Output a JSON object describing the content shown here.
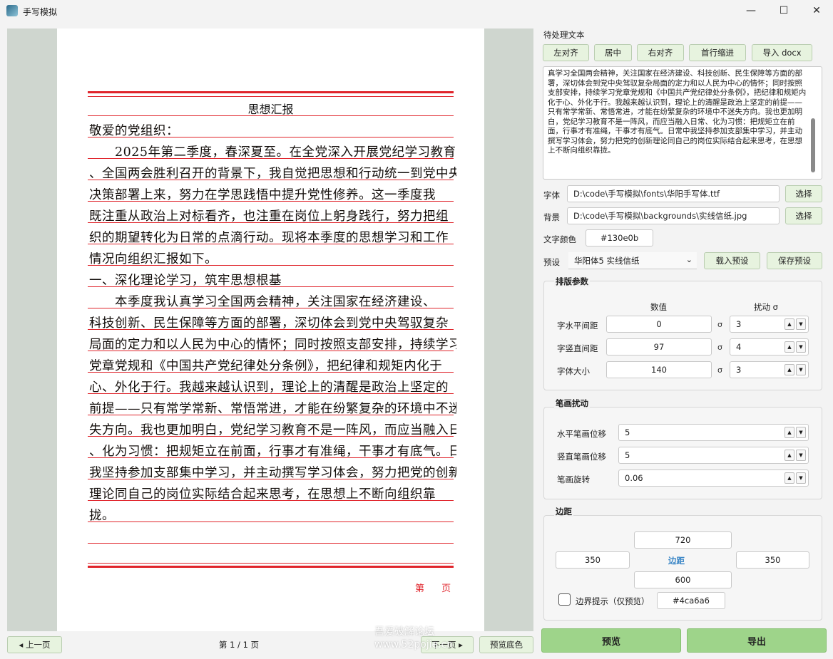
{
  "window": {
    "title": "手写模拟",
    "minimize": "—",
    "maximize": "☐",
    "close": "✕"
  },
  "paper": {
    "title": "思想汇报",
    "lines": [
      "敬爱的党组织：",
      "　　2025年第二季度，春深夏至。在全党深入开展党纪学习教育",
      "、全国两会胜利召开的背景下，我自觉把思想和行动统一到党中央",
      "决策部署上来，努力在学思践悟中提升党性修养。这一季度我",
      "既注重从政治上对标看齐，也注重在岗位上躬身践行，努力把组",
      "织的期望转化为日常的点滴行动。现将本季度的思想学习和工作",
      "情况向组织汇报如下。",
      "一、深化理论学习，筑牢思想根基",
      "　　本季度我认真学习全国两会精神，关注国家在经济建设、",
      "科技创新、民生保障等方面的部署，深切体会到党中央驾驭复杂",
      "局面的定力和以人民为中心的情怀；同时按照支部安排，持续学习",
      "党章党规和《中国共产党纪律处分条例》，把纪律和规矩内化于",
      "心、外化于行。我越来越认识到，理论上的清醒是政治上坚定的",
      "前提——只有常学常新、常悟常进，才能在纷繁复杂的环境中不迷",
      "失方向。我也更加明白，党纪学习教育不是一阵风，而应当融入日常",
      "、化为习惯：把规矩立在前面，行事才有准绳，干事才有底气。日常中",
      "我坚持参加支部集中学习，并主动撰写学习体会，努力把党的创新",
      "理论同自己的岗位实际结合起来思考，在思想上不断向组织靠",
      "拢。"
    ],
    "page_label": "第 页"
  },
  "nav": {
    "prev": "◂ 上一页",
    "indicator": "第 1 / 1 页",
    "next": "下一页 ▸",
    "preview_bg": "预览底色"
  },
  "watermark": {
    "line1": "吾爱破解论坛",
    "line2": "www.52pojie.cn"
  },
  "panel": {
    "text_label": "待处理文本",
    "align_left": "左对齐",
    "align_center": "居中",
    "align_right": "右对齐",
    "indent": "首行缩进",
    "import_docx": "导入 docx",
    "text_content": "真学习全国两会精神，关注国家在经济建设、科技创新、民生保障等方面的部署，深切体会到党中央驾驭复杂局面的定力和以人民为中心的情怀；同时按照支部安排，持续学习党章党规和《中国共产党纪律处分条例》，把纪律和规矩内化于心、外化于行。我越来越认识到，理论上的清醒是政治上坚定的前提——只有常学常新、常悟常进，才能在纷繁复杂的环境中不迷失方向。我也更加明白，党纪学习教育不是一阵风，而应当融入日常、化为习惯：把规矩立在前面，行事才有准绳，干事才有底气。日常中我坚持参加支部集中学习，并主动撰写学习体会，努力把党的创新理论同自己的岗位实际结合起来思考，在思想上不断向组织靠拢。",
    "font_label": "字体",
    "font_path": "D:\\code\\手写模拟\\fonts\\华阳手写体.ttf",
    "font_select": "选择",
    "bg_label": "背景",
    "bg_path": "D:\\code\\手写模拟\\backgrounds\\实线信纸.jpg",
    "bg_select": "选择",
    "color_label": "文字颜色",
    "color_value": "#130e0b",
    "preset_label": "预设",
    "preset_value": "华阳体5 实线信纸",
    "load_preset": "载入预设",
    "save_preset": "保存预设",
    "layout_title": "排版参数",
    "col_value": "数值",
    "col_jitter": "扰动 σ",
    "sigma": "σ",
    "h_spacing_label": "字水平间距",
    "h_spacing_value": "0",
    "h_spacing_jitter": "3",
    "v_spacing_label": "字竖直间距",
    "v_spacing_value": "97",
    "v_spacing_jitter": "4",
    "size_label": "字体大小",
    "size_value": "140",
    "size_jitter": "3",
    "stroke_title": "笔画扰动",
    "stroke_h_label": "水平笔画位移",
    "stroke_h_value": "5",
    "stroke_v_label": "竖直笔画位移",
    "stroke_v_value": "5",
    "stroke_rot_label": "笔画旋转",
    "stroke_rot_value": "0.06",
    "margin_title": "边距",
    "margin_top": "720",
    "margin_left": "350",
    "margin_center": "边距",
    "margin_right": "350",
    "margin_bottom": "600",
    "boundary_label": "边界提示（仅预览）",
    "boundary_color": "#4ca6a6",
    "preview_btn": "预览",
    "export_btn": "导出"
  },
  "colors": {
    "ink": "#130e0b",
    "red_line": "#e0242b",
    "button_bg": "#e7f3df",
    "primary_btn": "#9ed48a",
    "accent_blue": "#3a86c6"
  }
}
